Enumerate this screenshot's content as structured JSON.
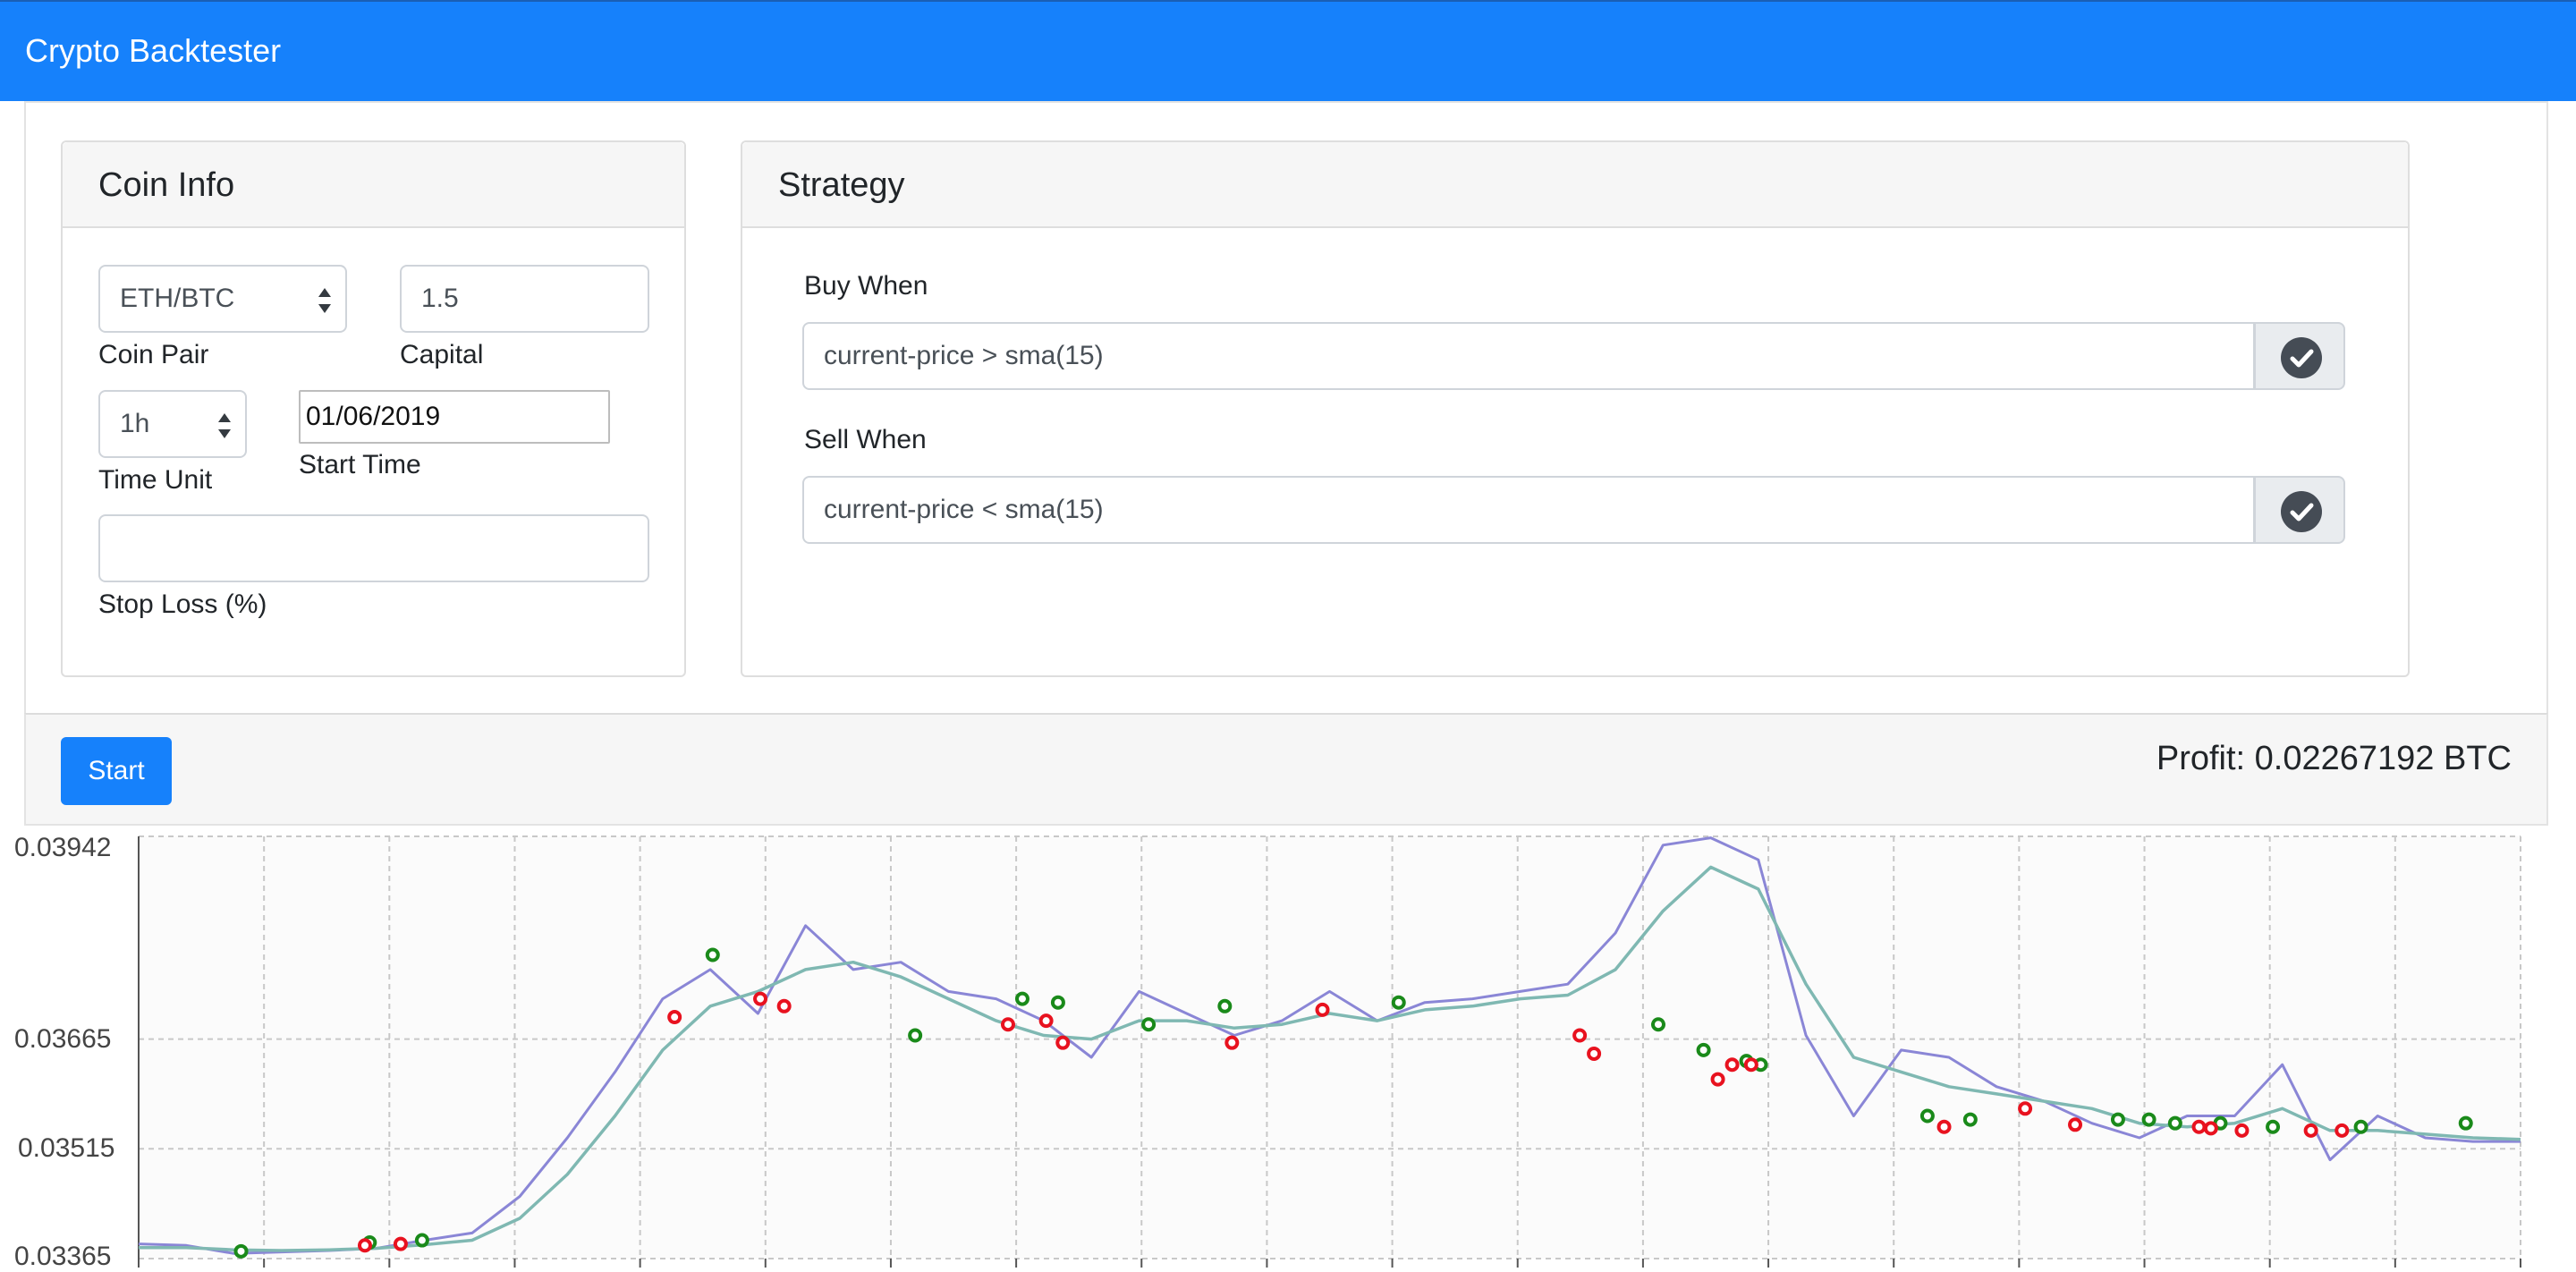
{
  "navbar": {
    "title": "Crypto Backtester"
  },
  "coin_info": {
    "title": "Coin Info",
    "coin_pair": {
      "value": "ETH/BTC",
      "label": "Coin Pair"
    },
    "capital": {
      "value": "1.5",
      "label": "Capital"
    },
    "time_unit": {
      "value": "1h",
      "label": "Time Unit"
    },
    "start_time": {
      "value": "01/06/2019",
      "label": "Start Time"
    },
    "stop_loss": {
      "value": "",
      "label": "Stop Loss (%)"
    }
  },
  "strategy": {
    "title": "Strategy",
    "buy": {
      "label": "Buy When",
      "value": "current-price > sma(15)"
    },
    "sell": {
      "label": "Sell When",
      "value": "current-price < sma(15)"
    }
  },
  "actions": {
    "start_label": "Start",
    "profit": "Profit: 0.02267192 BTC"
  },
  "colors": {
    "accent": "#1681fb",
    "price_line": "#8a86d6",
    "sma_line": "#7fb8b2",
    "buy_marker": "#1a8a1a",
    "sell_marker": "#e8121f"
  },
  "icons": {
    "validate_buy": "check-circle-icon",
    "validate_sell": "check-circle-icon"
  },
  "chart_data": {
    "type": "line",
    "ylim": [
      0.03365,
      0.03942
    ],
    "ytick_labels": [
      "0.03942",
      "0.03665",
      "0.03515",
      "0.03365"
    ],
    "grid": true,
    "x": [
      0,
      2,
      4,
      6,
      8,
      10,
      12,
      14,
      16,
      18,
      20,
      22,
      24,
      26,
      28,
      30,
      32,
      34,
      36,
      38,
      40,
      42,
      44,
      46,
      48,
      50,
      52,
      54,
      56,
      58,
      60,
      62,
      64,
      66,
      68,
      70,
      72,
      74,
      76,
      78,
      80,
      82,
      84,
      86,
      88,
      90,
      92,
      94,
      96,
      98,
      100
    ],
    "series": [
      {
        "values": [
          0.03385,
          0.03383,
          0.03372,
          0.03374,
          0.03376,
          0.03379,
          0.0339,
          0.034,
          0.0345,
          0.0353,
          0.0362,
          0.0372,
          0.0376,
          0.037,
          0.0382,
          0.0376,
          0.0377,
          0.0373,
          0.0372,
          0.0369,
          0.0364,
          0.0373,
          0.037,
          0.0367,
          0.0369,
          0.0373,
          0.0369,
          0.03715,
          0.0372,
          0.0373,
          0.0374,
          0.0381,
          0.0393,
          0.0394,
          0.0391,
          0.0367,
          0.0356,
          0.0365,
          0.0364,
          0.036,
          0.0358,
          0.0355,
          0.0353,
          0.0356,
          0.0356,
          0.0363,
          0.035,
          0.0356,
          0.0353,
          0.03525,
          0.03525
        ]
      },
      {
        "values": [
          0.0338,
          0.0338,
          0.03377,
          0.03376,
          0.03377,
          0.03379,
          0.03384,
          0.0339,
          0.0342,
          0.0348,
          0.0356,
          0.0365,
          0.0371,
          0.0373,
          0.0376,
          0.0377,
          0.0375,
          0.0372,
          0.0369,
          0.0367,
          0.03665,
          0.0369,
          0.0369,
          0.0368,
          0.03685,
          0.037,
          0.0369,
          0.03705,
          0.0371,
          0.0372,
          0.03725,
          0.0376,
          0.0384,
          0.039,
          0.0387,
          0.0374,
          0.0364,
          0.0362,
          0.036,
          0.0359,
          0.0358,
          0.0357,
          0.0355,
          0.03545,
          0.0355,
          0.0357,
          0.0354,
          0.0354,
          0.03535,
          0.0353,
          0.03528
        ]
      }
    ],
    "buy_signals": [
      [
        4.3,
        0.03375
      ],
      [
        9.7,
        0.03387
      ],
      [
        11.9,
        0.0339
      ],
      [
        24.1,
        0.0378
      ],
      [
        32.6,
        0.0367
      ],
      [
        37.1,
        0.0372
      ],
      [
        38.6,
        0.03715
      ],
      [
        42.4,
        0.03685
      ],
      [
        45.6,
        0.0371
      ],
      [
        52.9,
        0.03715
      ],
      [
        63.8,
        0.03685
      ],
      [
        65.7,
        0.0365
      ],
      [
        67.5,
        0.03635
      ],
      [
        68.1,
        0.0363
      ],
      [
        75.1,
        0.0356
      ],
      [
        76.9,
        0.03555
      ],
      [
        83.1,
        0.03555
      ],
      [
        84.4,
        0.03555
      ],
      [
        85.5,
        0.0355
      ],
      [
        87.4,
        0.0355
      ],
      [
        89.6,
        0.03545
      ],
      [
        93.3,
        0.03545
      ],
      [
        97.7,
        0.0355
      ]
    ],
    "sell_signals": [
      [
        9.5,
        0.03383
      ],
      [
        11.0,
        0.03385
      ],
      [
        22.5,
        0.03695
      ],
      [
        26.1,
        0.0372
      ],
      [
        27.1,
        0.0371
      ],
      [
        36.5,
        0.03685
      ],
      [
        38.1,
        0.0369
      ],
      [
        38.8,
        0.0366
      ],
      [
        45.9,
        0.0366
      ],
      [
        49.7,
        0.03705
      ],
      [
        60.5,
        0.0367
      ],
      [
        61.1,
        0.03645
      ],
      [
        66.3,
        0.0361
      ],
      [
        66.9,
        0.0363
      ],
      [
        67.7,
        0.0363
      ],
      [
        79.2,
        0.0357
      ],
      [
        75.8,
        0.03545
      ],
      [
        81.3,
        0.03548
      ],
      [
        86.5,
        0.03545
      ],
      [
        87.0,
        0.03543
      ],
      [
        88.3,
        0.0354
      ],
      [
        91.2,
        0.0354
      ],
      [
        92.5,
        0.0354
      ]
    ]
  }
}
